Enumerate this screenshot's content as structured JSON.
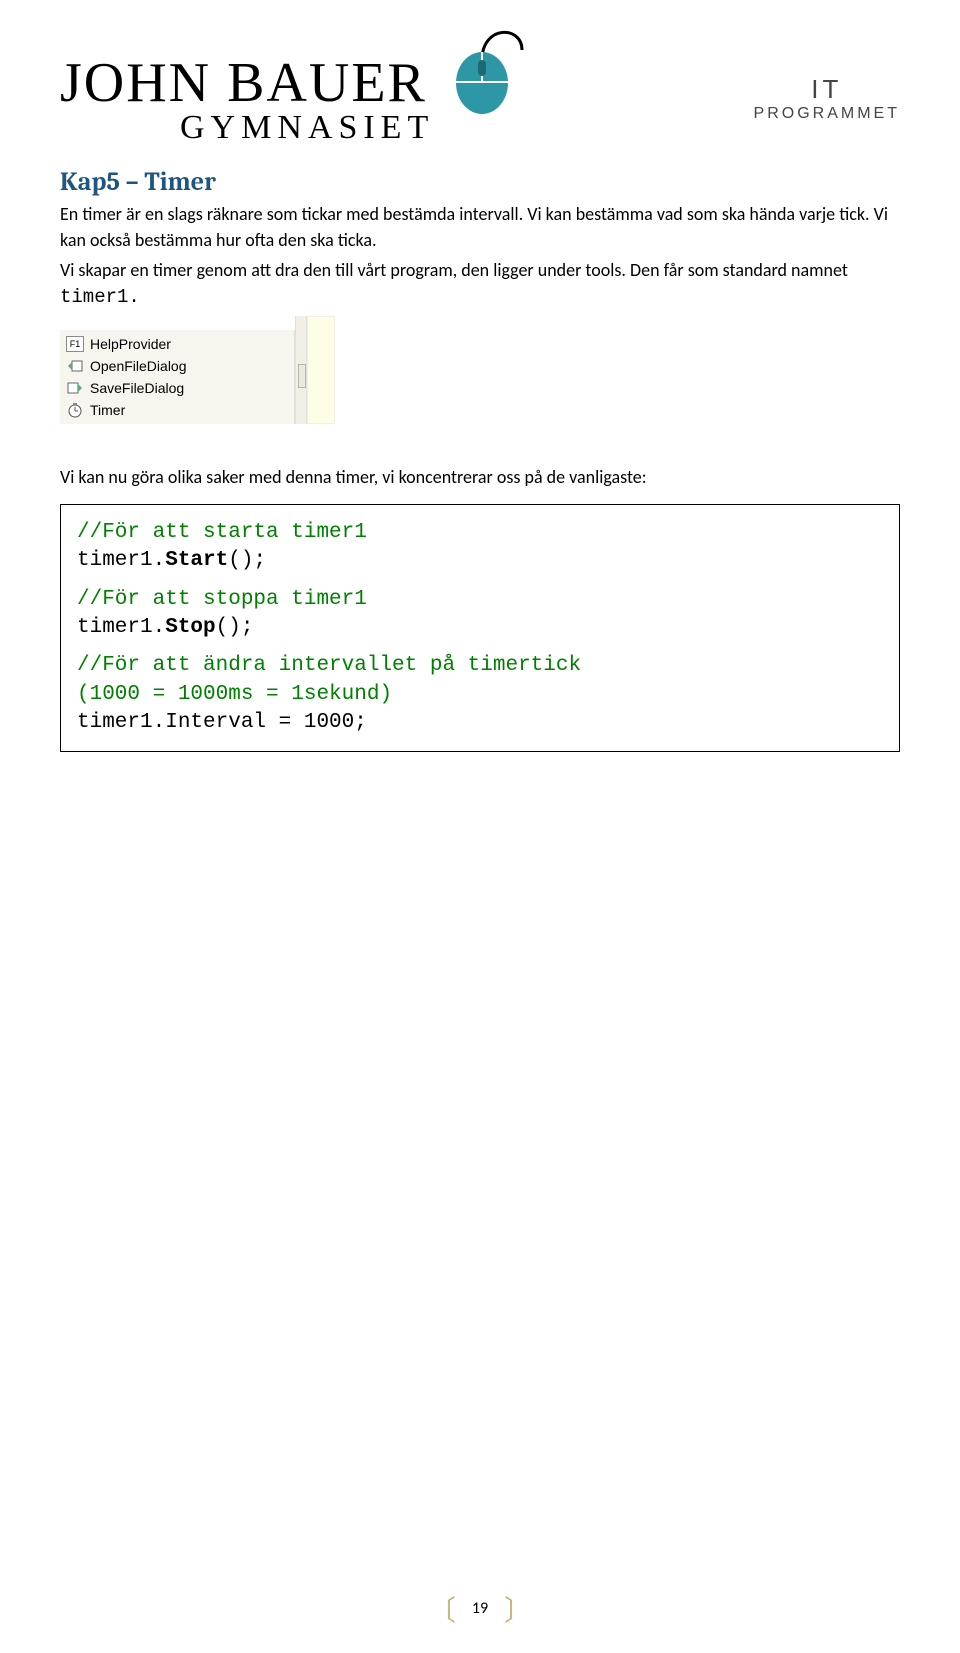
{
  "header": {
    "brand_top": "JOHN BAUER",
    "brand_bottom": "GYMNASIET",
    "prog_line1": "IT",
    "prog_line2": "PROGRAMMET"
  },
  "heading": "Kap5 – Timer",
  "para1": "En timer är en slags räknare som tickar med bestämda intervall. Vi kan bestämma vad som ska hända varje tick. Vi kan också bestämma hur ofta den ska ticka.",
  "para2_pre": "Vi skapar en timer genom att dra den till vårt program, den ligger under tools. Den får som standard namnet ",
  "para2_mono": "timer1.",
  "toolbox": {
    "items": [
      {
        "icon": "F1",
        "label": "HelpProvider"
      },
      {
        "icon": "ofd",
        "label": "OpenFileDialog"
      },
      {
        "icon": "sfd",
        "label": "SaveFileDialog"
      },
      {
        "icon": "timer",
        "label": "Timer"
      }
    ]
  },
  "para3": "Vi kan nu göra olika saker med denna timer, vi koncentrerar oss på de vanligaste:",
  "code": {
    "c1": "//För att starta timer1",
    "l1a": "timer1.",
    "l1b": "Start",
    "l1c": "();",
    "c2": "//För att stoppa timer1",
    "l2a": "timer1.",
    "l2b": "Stop",
    "l2c": "();",
    "c3a": "//För att ändra intervallet på timertick",
    "c3b": "(1000 = 1000ms = 1sekund)",
    "l3": "timer1.Interval = 1000;"
  },
  "page_number": "19"
}
